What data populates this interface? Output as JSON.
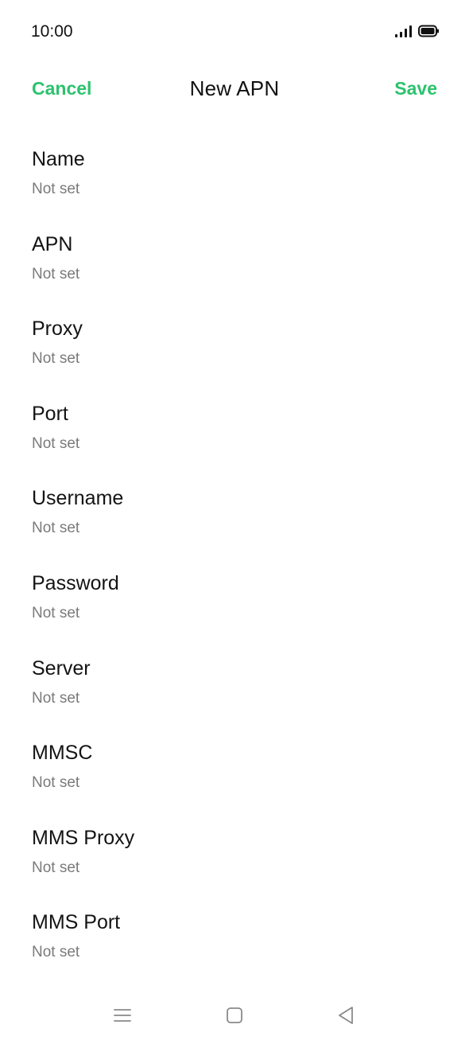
{
  "status_bar": {
    "time": "10:00",
    "icons": [
      "signal-icon",
      "battery-icon"
    ]
  },
  "header": {
    "cancel_label": "Cancel",
    "title": "New APN",
    "save_label": "Save"
  },
  "colors": {
    "accent": "#2dc26e",
    "text_primary": "#141414",
    "text_secondary": "#7a7a7a",
    "nav_icon": "#8a8a8a"
  },
  "fields": [
    {
      "label": "Name",
      "value": "Not set"
    },
    {
      "label": "APN",
      "value": "Not set"
    },
    {
      "label": "Proxy",
      "value": "Not set"
    },
    {
      "label": "Port",
      "value": "Not set"
    },
    {
      "label": "Username",
      "value": "Not set"
    },
    {
      "label": "Password",
      "value": "Not set"
    },
    {
      "label": "Server",
      "value": "Not set"
    },
    {
      "label": "MMSC",
      "value": "Not set"
    },
    {
      "label": "MMS Proxy",
      "value": "Not set"
    },
    {
      "label": "MMS Port",
      "value": "Not set"
    }
  ],
  "nav_bar": {
    "icons": [
      "menu-icon",
      "home-icon",
      "back-icon"
    ]
  }
}
